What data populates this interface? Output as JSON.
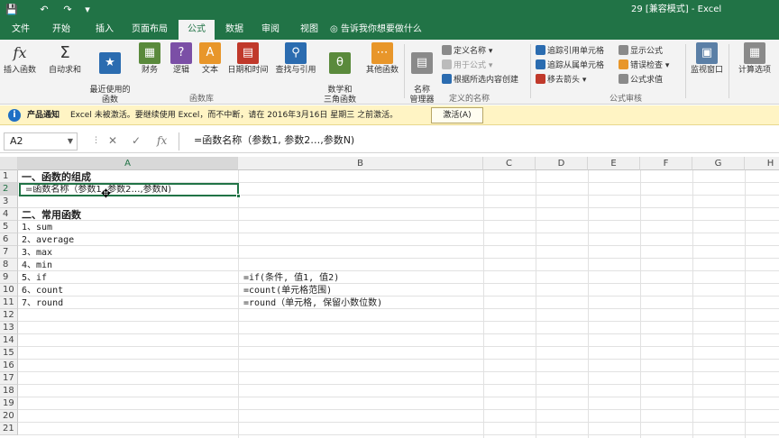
{
  "title_bar": {
    "title": "29  [兼容模式] - Excel"
  },
  "tabs": [
    "文件",
    "开始",
    "插入",
    "页面布局",
    "公式",
    "数据",
    "审阅",
    "视图"
  ],
  "active_tab": "公式",
  "tell_me": "告诉我你想要做什么",
  "ribbon": {
    "function_library": {
      "buttons": [
        "插入函数",
        "自动求和",
        "最近使用的\n函数",
        "财务",
        "逻辑",
        "文本",
        "日期和时间",
        "查找与引用",
        "数学和\n三角函数",
        "其他函数"
      ],
      "group_label": "函数库"
    },
    "defined_names": {
      "name_manager": "名称\n管理器",
      "define_name": "定义名称",
      "use_in_formula": "用于公式",
      "create_from_selection": "根据所选内容创建",
      "group_label": "定义的名称"
    },
    "formula_auditing": {
      "trace_precedents": "追踪引用单元格",
      "trace_dependents": "追踪从属单元格",
      "remove_arrows": "移去箭头",
      "show_formulas": "显示公式",
      "error_checking": "错误检查",
      "evaluate_formula": "公式求值",
      "group_label": "公式审核"
    },
    "watch_window": "监视窗口",
    "calc_options": "计算选项"
  },
  "notification": {
    "label": "产品通知",
    "message": "Excel 未被激活。要继续使用 Excel，而不中断，请在 2016年3月16日 星期三 之前激活。",
    "button": "激活(A)"
  },
  "formula_bar": {
    "name_box": "A2",
    "formula": "=函数名称（参数1, 参数2…,参数N)"
  },
  "columns": [
    "A",
    "B",
    "C",
    "D",
    "E",
    "F",
    "G",
    "H"
  ],
  "rows": [
    "1",
    "2",
    "3",
    "4",
    "5",
    "6",
    "7",
    "8",
    "9",
    "10",
    "11",
    "12",
    "13",
    "14",
    "15",
    "16",
    "17",
    "18",
    "19",
    "20",
    "21"
  ],
  "cells": {
    "A1": "一、函数的组成",
    "A2": "=函数名称（参数1, 参数2…,参数N)",
    "A4": "二、常用函数",
    "A5": "1、sum",
    "A6": "2、average",
    "A7": "3、max",
    "A8": "4、min",
    "A9": "5、if",
    "A10": "6、count",
    "A11": "7、round",
    "B9": "=if(条件, 值1, 值2)",
    "B10": "=count(单元格范围)",
    "B11": "=round（单元格, 保留小数位数)"
  },
  "colors": {
    "accent": "#217346"
  }
}
